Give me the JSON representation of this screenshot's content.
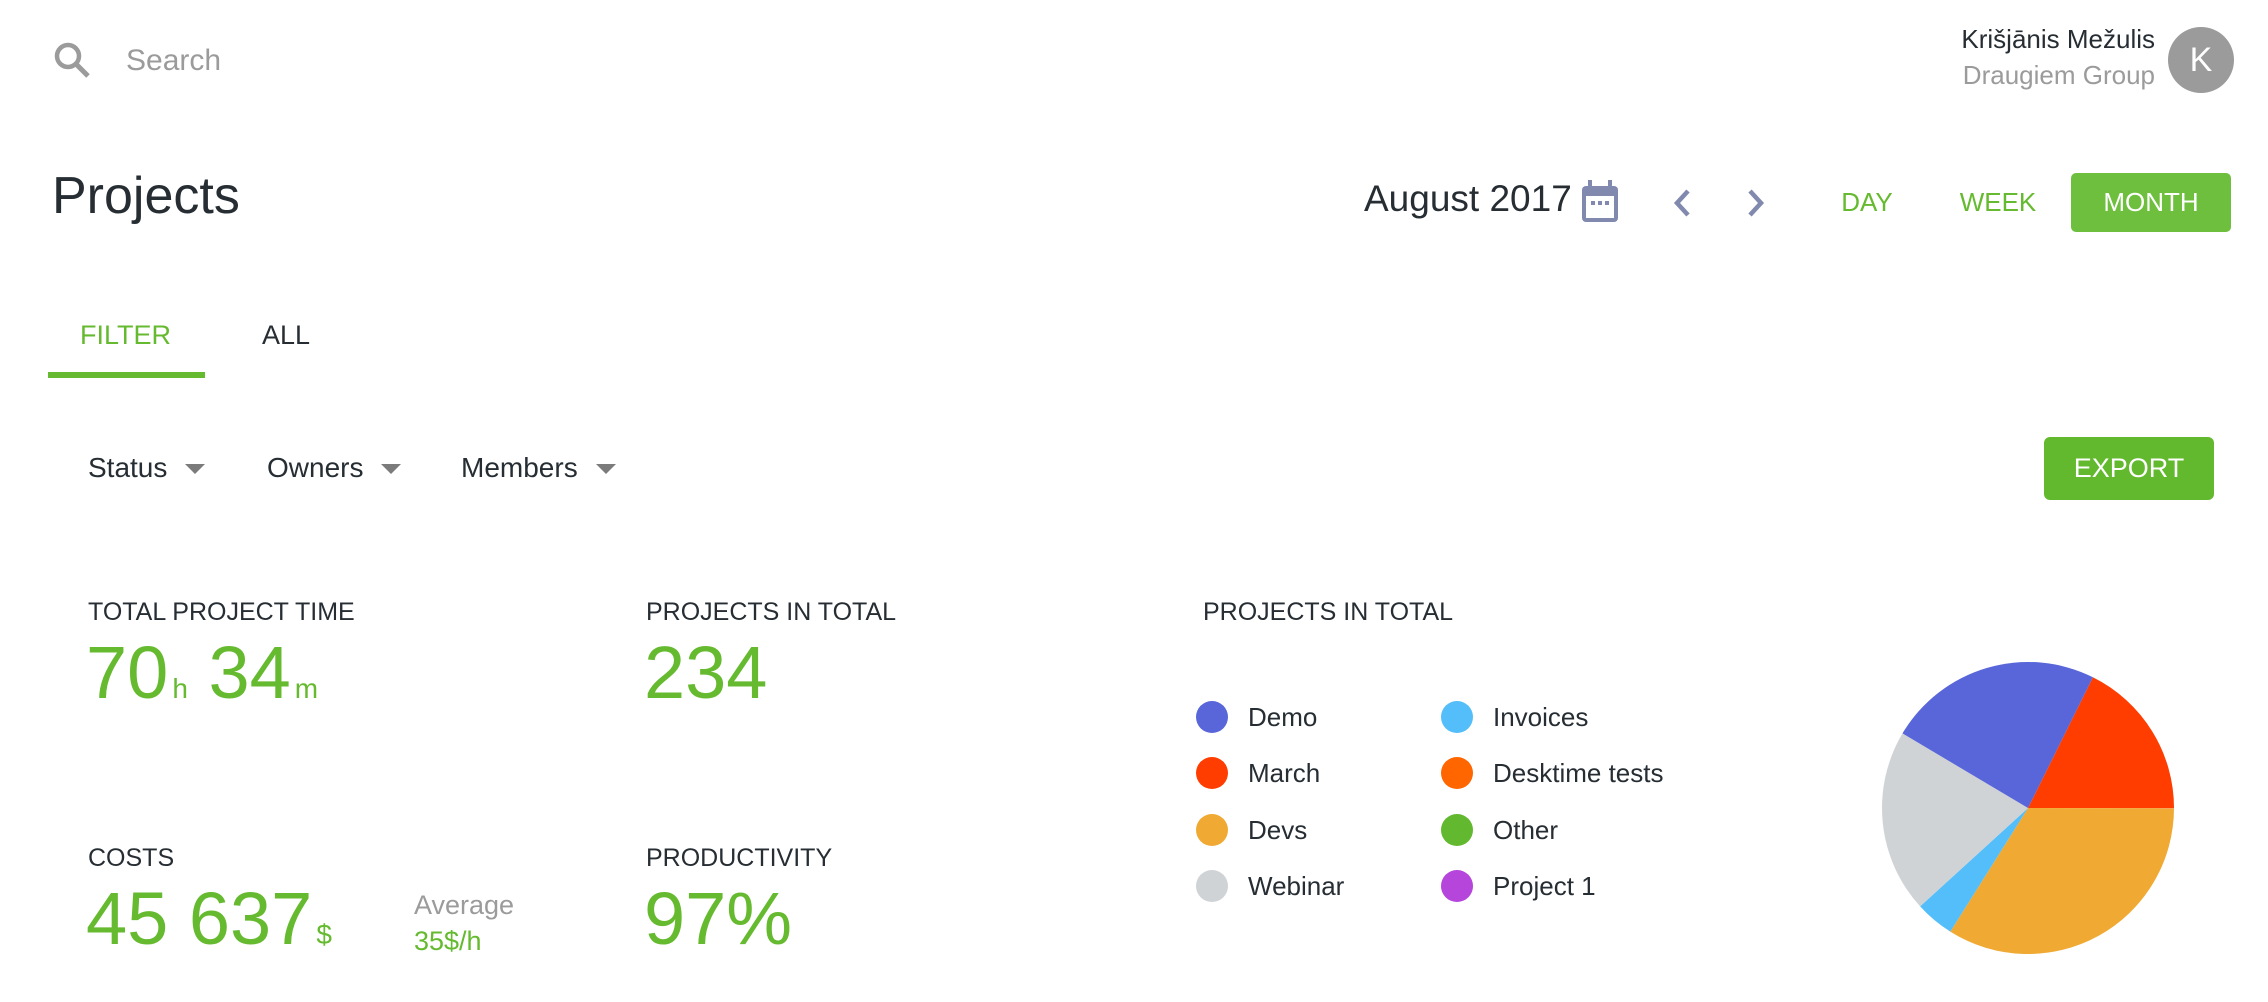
{
  "header": {
    "search": {
      "placeholder": "Search",
      "value": "",
      "icon": "search-icon"
    },
    "user": {
      "name": "Krišjānis Mežulis",
      "company": "Draugiem Group",
      "avatar_initial": "K"
    }
  },
  "page": {
    "title": "Projects",
    "date_label": "August 2017",
    "calendar_icon": "calendar-icon",
    "prev_icon": "chevron-left-icon",
    "next_icon": "chevron-right-icon",
    "range_buttons": [
      {
        "label": "DAY",
        "active": false
      },
      {
        "label": "WEEK",
        "active": false
      },
      {
        "label": "MONTH",
        "active": true
      }
    ],
    "accent_color": "#65ba2f"
  },
  "tabs": [
    {
      "label": "FILTER",
      "active": true
    },
    {
      "label": "ALL",
      "active": false
    }
  ],
  "filters": [
    {
      "label": "Status"
    },
    {
      "label": "Owners"
    },
    {
      "label": "Members"
    }
  ],
  "export_label": "EXPORT",
  "stats": {
    "total_time": {
      "label": "TOTAL PROJECT TIME",
      "hours": "70",
      "hours_unit": "h",
      "minutes": "34",
      "minutes_unit": "m"
    },
    "projects_total": {
      "label": "PROJECTS IN TOTAL",
      "value": "234"
    },
    "costs": {
      "label": "COSTS",
      "value": "45 637",
      "unit": "$",
      "average_label": "Average",
      "average_value": "35$/h"
    },
    "productivity": {
      "label": "PRODUCTIVITY",
      "value": "97%"
    }
  },
  "chart_data": {
    "type": "pie",
    "title": "PROJECTS IN TOTAL",
    "legend_placement": "left",
    "legend": [
      {
        "name": "Demo",
        "color": "#5866d9"
      },
      {
        "name": "March",
        "color": "#ff3d00"
      },
      {
        "name": "Devs",
        "color": "#f0aa33"
      },
      {
        "name": "Webinar",
        "color": "#d0d3d6"
      },
      {
        "name": "Invoices",
        "color": "#53befa"
      },
      {
        "name": "Desktime tests",
        "color": "#ff6600"
      },
      {
        "name": "Other",
        "color": "#62b82f"
      },
      {
        "name": "Project 1",
        "color": "#b545db"
      }
    ],
    "slices_clockwise_from_top": [
      {
        "name": "March",
        "percent": 17.7,
        "color": "#ff3d00"
      },
      {
        "name": "Devs",
        "percent": 33.9,
        "color": "#f0aa33"
      },
      {
        "name": "Invoices",
        "percent": 4.3,
        "color": "#53befa"
      },
      {
        "name": "Webinar",
        "percent": 20.3,
        "color": "#d0d3d6"
      },
      {
        "name": "Demo",
        "percent": 23.8,
        "color": "#5866d9"
      }
    ],
    "start_angle_deg": 26.4
  }
}
